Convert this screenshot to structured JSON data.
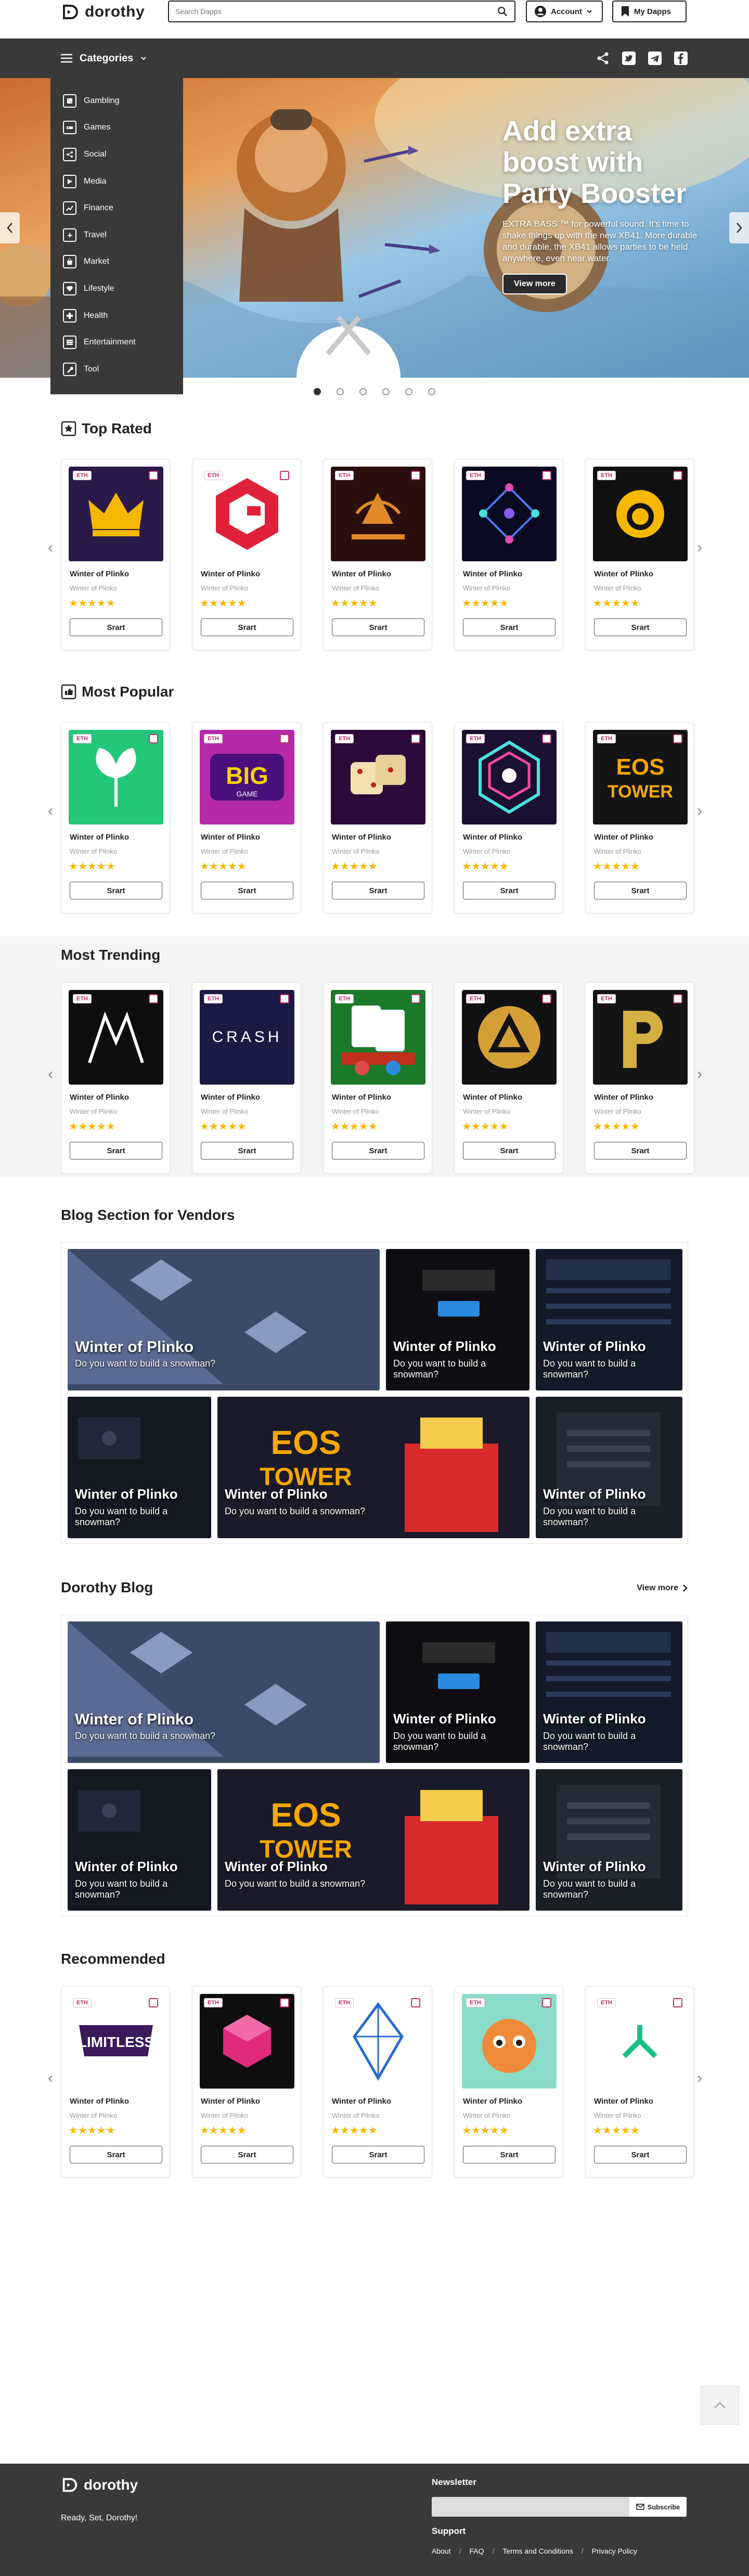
{
  "header": {
    "logo_text": "dorothy",
    "search_placeholder": "Search Dapps",
    "account_label": "Account",
    "mydapps_label": "My Dapps"
  },
  "nav": {
    "categories_label": "Categories",
    "social_icons": [
      "share-icon",
      "twitter-icon",
      "telegram-icon",
      "facebook-icon"
    ]
  },
  "categories": [
    {
      "label": "Gambling",
      "icon": "dice-icon"
    },
    {
      "label": "Games",
      "icon": "gamepad-icon"
    },
    {
      "label": "Social",
      "icon": "share-icon"
    },
    {
      "label": "Media",
      "icon": "play-icon"
    },
    {
      "label": "Finance",
      "icon": "chart-icon"
    },
    {
      "label": "Travel",
      "icon": "plane-icon"
    },
    {
      "label": "Market",
      "icon": "bag-icon"
    },
    {
      "label": "Lifestyle",
      "icon": "heart-icon"
    },
    {
      "label": "Health",
      "icon": "cross-icon"
    },
    {
      "label": "Entertainment",
      "icon": "film-icon"
    },
    {
      "label": "Tool",
      "icon": "wrench-icon"
    }
  ],
  "hero": {
    "title": "Add extra boost with Party Booster",
    "description": "EXTRA BASS ™ for powerful sound. It's time to shake things up with the new XB41. More durable and durable, the XB41 allows parties to be held anywhere, even near water.",
    "button": "View more",
    "slide_count": 6,
    "active_slide": 1
  },
  "card_common": {
    "title": "Winter of Plinko",
    "subtitle": "Winter of Plinko",
    "badge": "ETH",
    "button": "Srart",
    "stars": "★★★★★"
  },
  "top_rated": {
    "title": "Top Rated",
    "thumbs": [
      "crown",
      "hexagon-g",
      "royal-vegas",
      "network",
      "lion"
    ]
  },
  "most_popular": {
    "title": "Most Popular",
    "thumbs": [
      "leaf",
      "big-game",
      "dice",
      "crystal",
      "eos-tower"
    ]
  },
  "most_trending": {
    "title": "Most Trending",
    "thumbs": [
      "triple-m",
      "crash",
      "blackjack",
      "triangle",
      "p-logo"
    ]
  },
  "recommended": {
    "title": "Recommended",
    "thumbs": [
      "limitless",
      "cube",
      "eos",
      "fox",
      "arrow"
    ]
  },
  "blog_vendors": {
    "title": "Blog Section for Vendors",
    "tiles": [
      {
        "title": "Winter of Plinko",
        "text": "Do you want to build a snowman?"
      },
      {
        "title": "Winter of Plinko",
        "text": "Do you want to build a snowman?"
      },
      {
        "title": "Winter of Plinko",
        "text": "Do you want to build a snowman?"
      },
      {
        "title": "Winter of Plinko",
        "text": "Do you want to build a snowman?"
      },
      {
        "title": "Winter of Plinko",
        "text": "Do you want to build a snowman?"
      },
      {
        "title": "Winter of Plinko",
        "text": "Do you want to build a snowman?"
      }
    ]
  },
  "dorothy_blog": {
    "title": "Dorothy Blog",
    "view_more": "View more",
    "tiles": [
      {
        "title": "Winter of Plinko",
        "text": "Do you want to build a snowman?"
      },
      {
        "title": "Winter of Plinko",
        "text": "Do you want to build a snowman?"
      },
      {
        "title": "Winter of Plinko",
        "text": "Do you want to build a snowman?"
      },
      {
        "title": "Winter of Plinko",
        "text": "Do you want to build a snowman?"
      },
      {
        "title": "Winter of Plinko",
        "text": "Do you want to build a snowman?"
      },
      {
        "title": "Winter of Plinko",
        "text": "Do you want to build a snowman?"
      }
    ]
  },
  "footer": {
    "logo_text": "dorothy",
    "tagline": "Ready, Set, Dorothy!",
    "newsletter_title": "Newsletter",
    "subscribe": "Subscribe",
    "support_title": "Support",
    "links": [
      "About",
      "FAQ",
      "Terms and Conditions",
      "Privacy Policy"
    ]
  },
  "colors": {
    "accent": "#c0306d",
    "dark": "#393939",
    "star": "#f6b800"
  }
}
